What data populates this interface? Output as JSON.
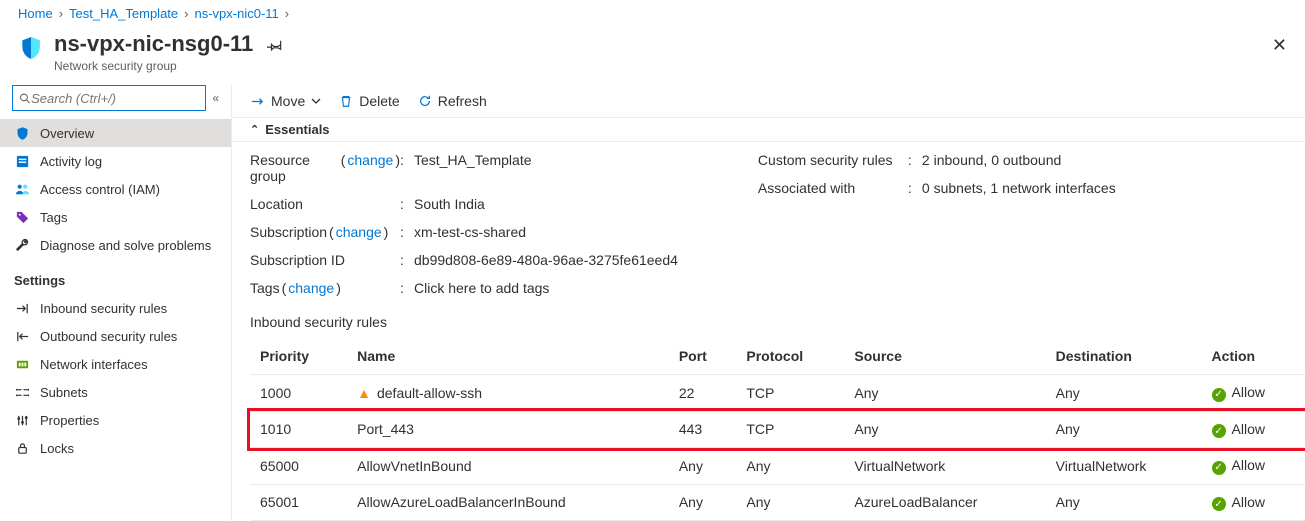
{
  "breadcrumbs": [
    "Home",
    "Test_HA_Template",
    "ns-vpx-nic0-11"
  ],
  "header": {
    "title": "ns-vpx-nic-nsg0-11",
    "subtitle": "Network security group"
  },
  "search": {
    "placeholder": "Search (Ctrl+/)"
  },
  "sidebar": {
    "items": [
      {
        "label": "Overview"
      },
      {
        "label": "Activity log"
      },
      {
        "label": "Access control (IAM)"
      },
      {
        "label": "Tags"
      },
      {
        "label": "Diagnose and solve problems"
      }
    ],
    "settings_label": "Settings",
    "settings": [
      {
        "label": "Inbound security rules"
      },
      {
        "label": "Outbound security rules"
      },
      {
        "label": "Network interfaces"
      },
      {
        "label": "Subnets"
      },
      {
        "label": "Properties"
      },
      {
        "label": "Locks"
      }
    ]
  },
  "commands": {
    "move": "Move",
    "delete": "Delete",
    "refresh": "Refresh"
  },
  "essentials": {
    "header": "Essentials",
    "change": "change",
    "left": {
      "rg_label": "Resource group",
      "rg_value": "Test_HA_Template",
      "loc_label": "Location",
      "loc_value": "South India",
      "sub_label": "Subscription",
      "sub_value": "xm-test-cs-shared",
      "subid_label": "Subscription ID",
      "subid_value": "db99d808-6e89-480a-96ae-3275fe61eed4",
      "tags_label": "Tags",
      "tags_value": "Click here to add tags"
    },
    "right": {
      "rules_label": "Custom security rules",
      "rules_value": "2 inbound, 0 outbound",
      "assoc_label": "Associated with",
      "assoc_value": "0 subnets, 1 network interfaces"
    }
  },
  "rules": {
    "title": "Inbound security rules",
    "cols": {
      "priority": "Priority",
      "name": "Name",
      "port": "Port",
      "protocol": "Protocol",
      "source": "Source",
      "destination": "Destination",
      "action": "Action"
    },
    "rows": [
      {
        "priority": "1000",
        "name": "default-allow-ssh",
        "port": "22",
        "protocol": "TCP",
        "source": "Any",
        "destination": "Any",
        "action": "Allow",
        "warn": true
      },
      {
        "priority": "1010",
        "name": "Port_443",
        "port": "443",
        "protocol": "TCP",
        "source": "Any",
        "destination": "Any",
        "action": "Allow",
        "highlight": true
      },
      {
        "priority": "65000",
        "name": "AllowVnetInBound",
        "port": "Any",
        "protocol": "Any",
        "source": "VirtualNetwork",
        "destination": "VirtualNetwork",
        "action": "Allow"
      },
      {
        "priority": "65001",
        "name": "AllowAzureLoadBalancerInBound",
        "port": "Any",
        "protocol": "Any",
        "source": "AzureLoadBalancer",
        "destination": "Any",
        "action": "Allow"
      }
    ]
  }
}
